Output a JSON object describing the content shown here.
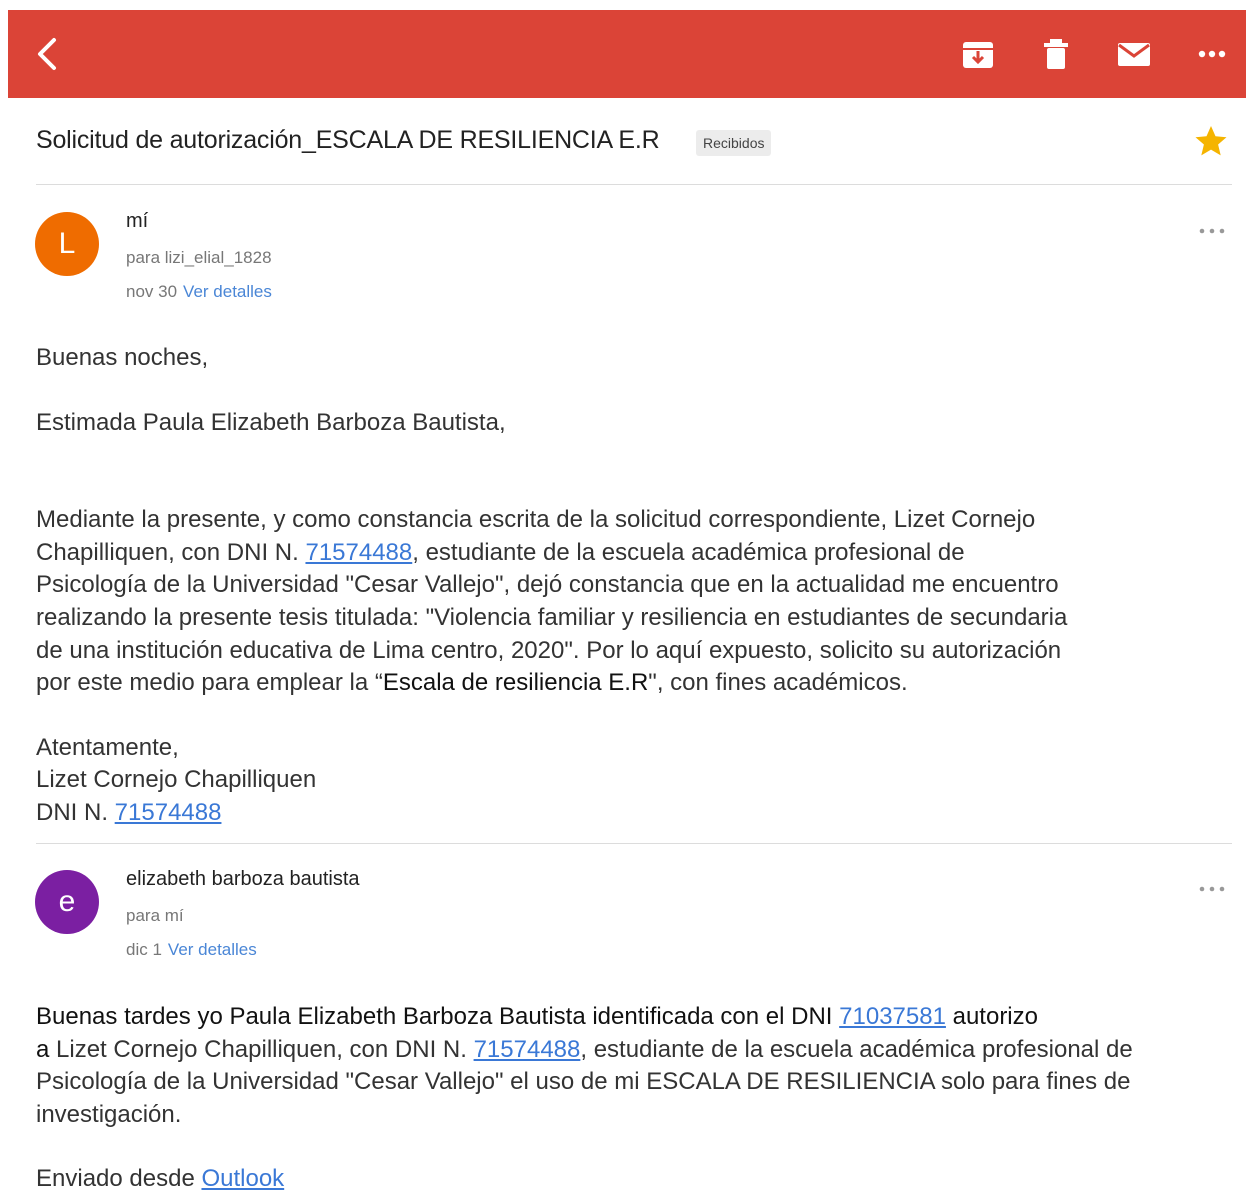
{
  "toolbar": {
    "icons": [
      "back-arrow-icon",
      "archive-icon",
      "trash-icon",
      "mail-icon",
      "more-horizontal-icon"
    ],
    "accent": "#db4437"
  },
  "thread": {
    "subject": "Solicitud de autorización_ESCALA DE RESILIENCIA E.R",
    "label": "Recibidos",
    "starred": true
  },
  "message1": {
    "avatar_letter": "L",
    "avatar_color": "#ef6c00",
    "sender": "mí",
    "to": "para lizi_elial_1828",
    "date": "nov 30",
    "details": "Ver detalles",
    "greeting": "Buenas noches,",
    "salutation": "Estimada Paula Elizabeth Barboza Bautista,",
    "p1_a": "Mediante la presente, y como constancia escrita de la solicitud correspondiente, Lizet Cornejo",
    "p1_b1": "Chapilliquen, con DNI N. ",
    "dni": "71574488",
    "p1_b2": ", estudiante de la escuela académica profesional de",
    "p1_c": "Psicología de la Universidad \"Cesar Vallejo\", dejó constancia que en la actualidad me encuentro",
    "p1_d": "realizando la presente tesis titulada: \"Violencia familiar y resiliencia en estudiantes de secundaria",
    "p1_e": "de una institución educativa de Lima centro, 2020\". Por lo aquí expuesto, solicito su autorización",
    "p1_f1": "por este medio para emplear la “",
    "p1_f_bold": "Escala de resiliencia E.R",
    "p1_f2": "\", con fines académicos.",
    "closing": "Atentamente,",
    "signature_name": "Lizet Cornejo Chapilliquen",
    "signature_dni_label": "DNI N. ",
    "signature_dni": "71574488"
  },
  "message2": {
    "avatar_letter": "e",
    "avatar_color": "#7b1fa2",
    "sender": "elizabeth barboza bautista",
    "to": "para mí",
    "date": "dic 1",
    "details": "Ver detalles",
    "l1_a": "Buenas tardes yo Paula Elizabeth Barboza Bautista identificada con el DNI ",
    "l1_dni": "71037581",
    "l1_b": " autorizo",
    "l2_a": "a",
    "l2_b": " Lizet Cornejo Chapilliquen, con DNI N. ",
    "l2_dni": "71574488",
    "l2_c": ", estudiante de la escuela académica profesional de",
    "l3": "Psicología de la Universidad \"Cesar Vallejo\" el uso de mi ESCALA DE RESILIENCIA solo para fines de",
    "l4": "investigación.",
    "sent_from": "Enviado desde ",
    "outlook": "Outlook"
  }
}
